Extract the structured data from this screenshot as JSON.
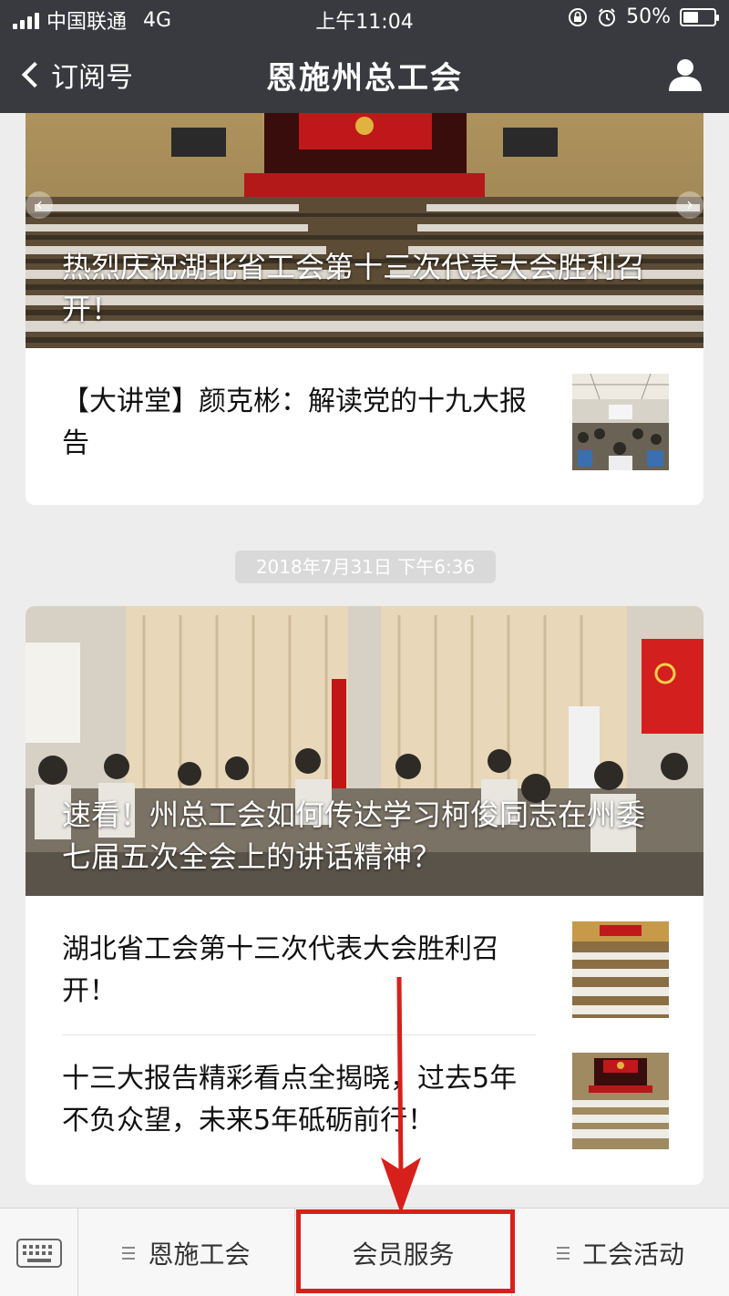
{
  "status_bar": {
    "carrier": "中国联通",
    "network": "4G",
    "time": "上午11:04",
    "battery": "50%",
    "battery_level": 0.5
  },
  "nav": {
    "back_label": "订阅号",
    "title": "恩施州总工会"
  },
  "feed": {
    "card1": {
      "cover_title": "热烈庆祝湖北省工会第十三次代表大会胜利召开！",
      "items": [
        {
          "title": "【大讲堂】颜克彬：解读党的十九大报告"
        }
      ]
    },
    "timestamp": "2018年7月31日 下午6:36",
    "card2": {
      "cover_title": "速看！州总工会如何传达学习柯俊同志在州委七届五次全会上的讲话精神？",
      "items": [
        {
          "title": "湖北省工会第十三次代表大会胜利召开！"
        },
        {
          "title": "十三大报告精彩看点全揭晓，过去5年不负众望，未来5年砥砺前行！"
        }
      ]
    }
  },
  "bottom_menu": {
    "items": [
      {
        "label": "恩施工会"
      },
      {
        "label": "会员服务"
      },
      {
        "label": "工会活动"
      }
    ]
  },
  "colors": {
    "header_bg": "#393a3f",
    "annotation_red": "#d7201b",
    "page_bg": "#ededed"
  }
}
